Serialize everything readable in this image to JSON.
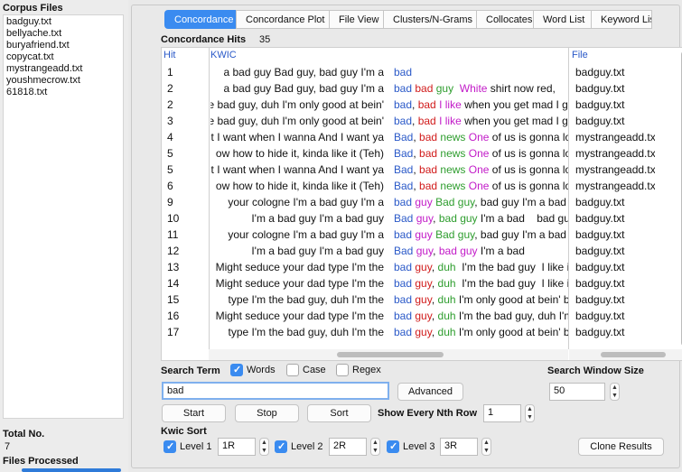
{
  "left": {
    "corpus_files_label": "Corpus Files",
    "files": [
      "badguy.txt",
      "bellyache.txt",
      "buryafriend.txt",
      "copycat.txt",
      "mystrangeadd.txt",
      "youshmecrow.txt",
      "61818.txt"
    ],
    "total_no_label": "Total No.",
    "total_no_value": "7",
    "files_processed_label": "Files Processed"
  },
  "tabs": [
    "Concordance",
    "Concordance Plot",
    "File View",
    "Clusters/N-Grams",
    "Collocates",
    "Word List",
    "Keyword List"
  ],
  "hits": {
    "label": "Concordance Hits",
    "value": "35"
  },
  "table": {
    "headers": {
      "hit": "Hit",
      "kwic": "KWIC",
      "file": "File"
    },
    "rows": [
      {
        "n": "1",
        "left": "a bad guy Bad guy, bad guy I'm a",
        "kw": [
          [
            "bad",
            "blue"
          ]
        ],
        "file": "badguy.txt"
      },
      {
        "n": "2",
        "left": "a bad guy Bad guy, bad guy I'm a",
        "kw": [
          [
            "bad",
            "blue"
          ],
          [
            " ",
            "b"
          ],
          [
            "bad",
            "red"
          ],
          [
            " ",
            "b"
          ],
          [
            "guy",
            "green"
          ],
          [
            "  ",
            "b"
          ],
          [
            "White",
            "mag"
          ],
          [
            " shirt now red,",
            "b"
          ]
        ],
        "file": "badguy.txt"
      },
      {
        "n": "2",
        "left": "e bad guy, duh I'm only good at bein'",
        "kw": [
          [
            "bad",
            "blue"
          ],
          [
            ", ",
            "b"
          ],
          [
            "bad",
            "red"
          ],
          [
            " ",
            "b"
          ],
          [
            "I like",
            "mag"
          ],
          [
            " when you get mad I g",
            "b"
          ]
        ],
        "file": "badguy.txt"
      },
      {
        "n": "3",
        "left": "e bad guy, duh I'm only good at bein'",
        "kw": [
          [
            "bad",
            "blue"
          ],
          [
            ", ",
            "b"
          ],
          [
            "bad",
            "red"
          ],
          [
            " ",
            "b"
          ],
          [
            "I like",
            "mag"
          ],
          [
            " when you get mad I g",
            "b"
          ]
        ],
        "file": "badguy.txt"
      },
      {
        "n": "4",
        "left": "t I want when I wanna And I want ya",
        "kw": [
          [
            "Bad",
            "blue"
          ],
          [
            ", ",
            "b"
          ],
          [
            "bad",
            "red"
          ],
          [
            " ",
            "b"
          ],
          [
            "news",
            "green"
          ],
          [
            " ",
            "b"
          ],
          [
            "One",
            "mag"
          ],
          [
            " of us is gonna los",
            "b"
          ]
        ],
        "file": "mystrangeadd.txt"
      },
      {
        "n": "5",
        "left": "ow how to hide it, kinda like it (Teh)",
        "kw": [
          [
            "Bad",
            "blue"
          ],
          [
            ", ",
            "b"
          ],
          [
            "bad",
            "red"
          ],
          [
            " ",
            "b"
          ],
          [
            "news",
            "green"
          ],
          [
            " ",
            "b"
          ],
          [
            "One",
            "mag"
          ],
          [
            " of us is gonna los",
            "b"
          ]
        ],
        "file": "mystrangeadd.txt"
      },
      {
        "n": "5",
        "left": "t I want when I wanna And I want ya",
        "kw": [
          [
            "Bad",
            "blue"
          ],
          [
            ", ",
            "b"
          ],
          [
            "bad",
            "red"
          ],
          [
            " ",
            "b"
          ],
          [
            "news",
            "green"
          ],
          [
            " ",
            "b"
          ],
          [
            "One",
            "mag"
          ],
          [
            " of us is gonna los",
            "b"
          ]
        ],
        "file": "mystrangeadd.txt"
      },
      {
        "n": "6",
        "left": "ow how to hide it, kinda like it (Teh)",
        "kw": [
          [
            "Bad",
            "blue"
          ],
          [
            ", ",
            "b"
          ],
          [
            "bad",
            "red"
          ],
          [
            " ",
            "b"
          ],
          [
            "news",
            "green"
          ],
          [
            " ",
            "b"
          ],
          [
            "One",
            "mag"
          ],
          [
            " of us is gonna los",
            "b"
          ]
        ],
        "file": "mystrangeadd.txt"
      },
      {
        "n": "9",
        "left": "your cologne  I'm a bad guy I'm a",
        "kw": [
          [
            "bad",
            "blue"
          ],
          [
            " ",
            "b"
          ],
          [
            "guy",
            "mag"
          ],
          [
            " ",
            "b"
          ],
          [
            "Bad guy",
            "green"
          ],
          [
            ", bad guy I'm a bad",
            "b"
          ]
        ],
        "file": "badguy.txt"
      },
      {
        "n": "10",
        "left": "I'm a bad guy I'm a bad guy",
        "kw": [
          [
            "Bad",
            "blue"
          ],
          [
            " ",
            "b"
          ],
          [
            "guy",
            "mag"
          ],
          [
            ", ",
            "b"
          ],
          [
            "bad guy",
            "green"
          ],
          [
            " I'm a bad    bad guy",
            "b"
          ]
        ],
        "file": "badguy.txt"
      },
      {
        "n": "11",
        "left": "your cologne  I'm a bad guy I'm a",
        "kw": [
          [
            "bad",
            "blue"
          ],
          [
            " ",
            "b"
          ],
          [
            "guy",
            "mag"
          ],
          [
            " ",
            "b"
          ],
          [
            "Bad guy",
            "green"
          ],
          [
            ", bad guy I'm a bad",
            "b"
          ]
        ],
        "file": "badguy.txt"
      },
      {
        "n": "12",
        "left": "I'm a bad guy I'm a bad guy",
        "kw": [
          [
            "Bad",
            "blue"
          ],
          [
            " ",
            "b"
          ],
          [
            "guy",
            "mag"
          ],
          [
            ", ",
            "b"
          ],
          [
            "bad guy",
            "mag"
          ],
          [
            " I'm a bad",
            "b"
          ]
        ],
        "file": "badguy.txt"
      },
      {
        "n": "13",
        "left": "Might seduce your dad type I'm the",
        "kw": [
          [
            "bad",
            "blue"
          ],
          [
            " ",
            "b"
          ],
          [
            "guy",
            "red"
          ],
          [
            ", ",
            "b"
          ],
          [
            "duh",
            "green"
          ],
          [
            "  I'm the bad guy  I like it",
            "b"
          ]
        ],
        "file": "badguy.txt"
      },
      {
        "n": "14",
        "left": "Might seduce your dad type I'm the",
        "kw": [
          [
            "bad",
            "blue"
          ],
          [
            " ",
            "b"
          ],
          [
            "guy",
            "red"
          ],
          [
            ", ",
            "b"
          ],
          [
            "duh",
            "green"
          ],
          [
            "  I'm the bad guy  I like it",
            "b"
          ]
        ],
        "file": "badguy.txt"
      },
      {
        "n": "15",
        "left": "type I'm the bad guy, duh  I'm the",
        "kw": [
          [
            "bad",
            "blue"
          ],
          [
            " ",
            "b"
          ],
          [
            "guy",
            "red"
          ],
          [
            ", ",
            "b"
          ],
          [
            "duh",
            "green"
          ],
          [
            " I'm only good at bein' ba",
            "b"
          ]
        ],
        "file": "badguy.txt"
      },
      {
        "n": "16",
        "left": "Might seduce your dad type I'm the",
        "kw": [
          [
            "bad",
            "blue"
          ],
          [
            " ",
            "b"
          ],
          [
            "guy",
            "red"
          ],
          [
            ", ",
            "b"
          ],
          [
            "duh",
            "green"
          ],
          [
            " I'm the bad guy, duh I'm",
            "b"
          ]
        ],
        "file": "badguy.txt"
      },
      {
        "n": "17",
        "left": "type I'm the bad guy, duh  I'm the",
        "kw": [
          [
            "bad",
            "blue"
          ],
          [
            " ",
            "b"
          ],
          [
            "guy",
            "red"
          ],
          [
            ", ",
            "b"
          ],
          [
            "duh",
            "green"
          ],
          [
            " I'm only good at bein' ba",
            "b"
          ]
        ],
        "file": "badguy.txt"
      }
    ]
  },
  "search": {
    "term_label": "Search Term",
    "words_label": "Words",
    "case_label": "Case",
    "regex_label": "Regex",
    "value": "bad",
    "advanced_label": "Advanced",
    "window_label": "Search Window Size",
    "window_value": "50",
    "start_label": "Start",
    "stop_label": "Stop",
    "sort_label": "Sort",
    "nth_label": "Show Every Nth Row",
    "nth_value": "1"
  },
  "kwic_sort": {
    "label": "Kwic Sort",
    "level1_label": "Level 1",
    "level1_value": "1R",
    "level2_label": "Level 2",
    "level2_value": "2R",
    "level3_label": "Level 3",
    "level3_value": "3R",
    "clone_label": "Clone Results"
  },
  "colors": {
    "accent": "#3a8bf0",
    "kw_blue": "#2a59c8",
    "kw_red": "#d11b1b",
    "kw_green": "#2e9d2e",
    "kw_magenta": "#c21bc8"
  }
}
